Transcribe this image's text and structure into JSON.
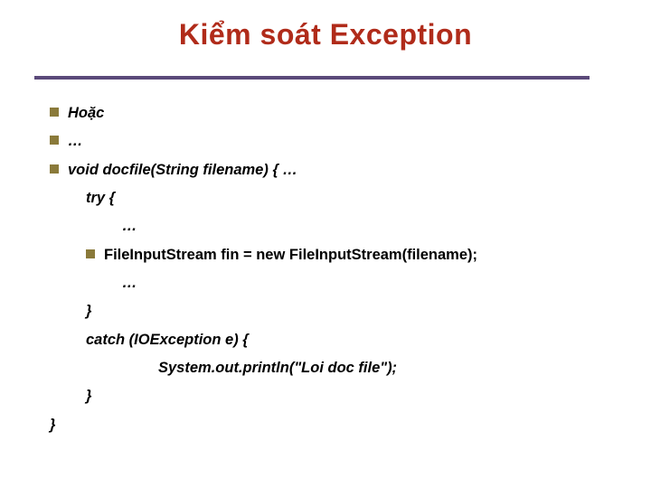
{
  "title": "Kiểm soát Exception",
  "lines": {
    "l0": "Hoặc",
    "l1": "…",
    "l2": "void docfile(String  filename) {  …",
    "l3": "try {",
    "l4": "…",
    "l5": "FileInputStream fin = new FileInputStream(filename);",
    "l6": "…",
    "l7": "}",
    "l8": "catch (IOException e) {",
    "l9": "System.out.println(\"Loi doc file\");",
    "l10": "}",
    "l11": "}"
  }
}
